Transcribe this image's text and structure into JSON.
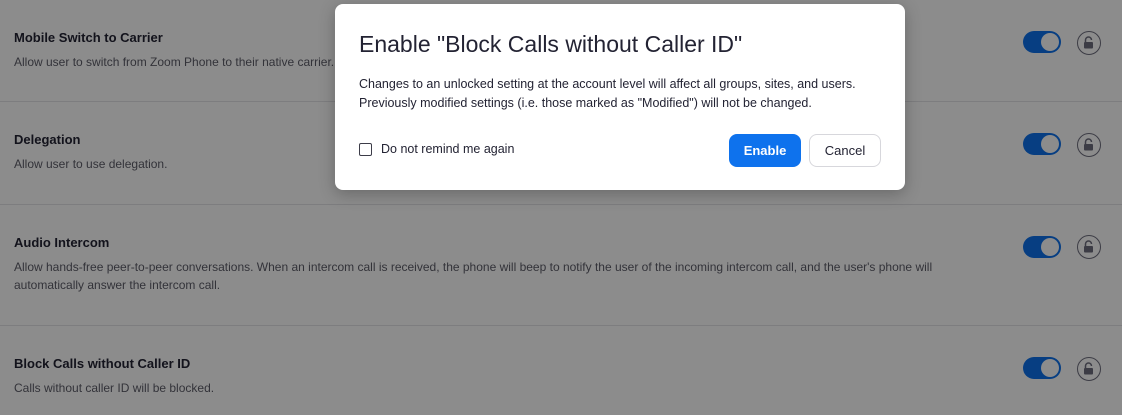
{
  "settings": [
    {
      "title": "Mobile Switch to Carrier",
      "description": "Allow user to switch from Zoom Phone to their native carrier.",
      "enabled": true,
      "lock_icon": "unlocked-lock-icon"
    },
    {
      "title": "Delegation",
      "description": "Allow user to use delegation.",
      "enabled": true,
      "lock_icon": "unlocked-lock-icon"
    },
    {
      "title": "Audio Intercom",
      "description": "Allow hands-free peer-to-peer conversations. When an intercom call is received, the phone will beep to notify the user of the incoming intercom call, and the user's phone will automatically answer the intercom call.",
      "enabled": true,
      "lock_icon": "unlocked-lock-icon"
    },
    {
      "title": "Block Calls without Caller ID",
      "description": "Calls without caller ID will be blocked.",
      "enabled": true,
      "lock_icon": "unlocked-lock-icon"
    }
  ],
  "dialog": {
    "title": "Enable \"Block Calls without Caller ID\"",
    "body_line_1": "Changes to an unlocked setting at the account level will affect all groups, sites, and users.",
    "body_line_2": "Previously modified settings (i.e. those marked as \"Modified\") will not be changed.",
    "checkbox_label": "Do not remind me again",
    "checkbox_checked": false,
    "enable_label": "Enable",
    "cancel_label": "Cancel"
  },
  "colors": {
    "accent": "#0e72ed",
    "overlay": "rgba(0,0,0,0.45)"
  }
}
